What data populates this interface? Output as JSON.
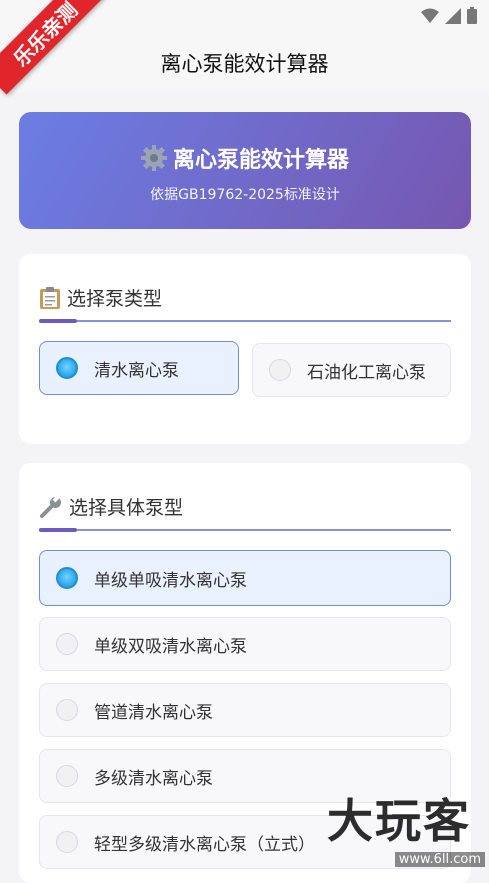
{
  "watermark": {
    "ribbon": "乐乐亲测",
    "brand": "大玩客",
    "site": "www.6ll.com"
  },
  "app_bar": {
    "title": "离心泵能效计算器"
  },
  "hero": {
    "icon": "gear-icon",
    "title": "离心泵能效计算器",
    "subtitle": "依据GB19762-2025标准设计"
  },
  "pump_type_section": {
    "icon": "clipboard-icon",
    "title": "选择泵类型",
    "options": [
      {
        "label": "清水离心泵",
        "selected": true
      },
      {
        "label": "石油化工离心泵",
        "selected": false
      }
    ]
  },
  "pump_model_section": {
    "icon": "wrench-icon",
    "title": "选择具体泵型",
    "options": [
      {
        "label": "单级单吸清水离心泵",
        "selected": true
      },
      {
        "label": "单级双吸清水离心泵",
        "selected": false
      },
      {
        "label": "管道清水离心泵",
        "selected": false
      },
      {
        "label": "多级清水离心泵",
        "selected": false
      },
      {
        "label": "轻型多级清水离心泵（立式）",
        "selected": false
      }
    ]
  },
  "colors": {
    "accent": "#6f8ee0",
    "hero_start": "#6b7ee4",
    "hero_end": "#7657b0"
  }
}
